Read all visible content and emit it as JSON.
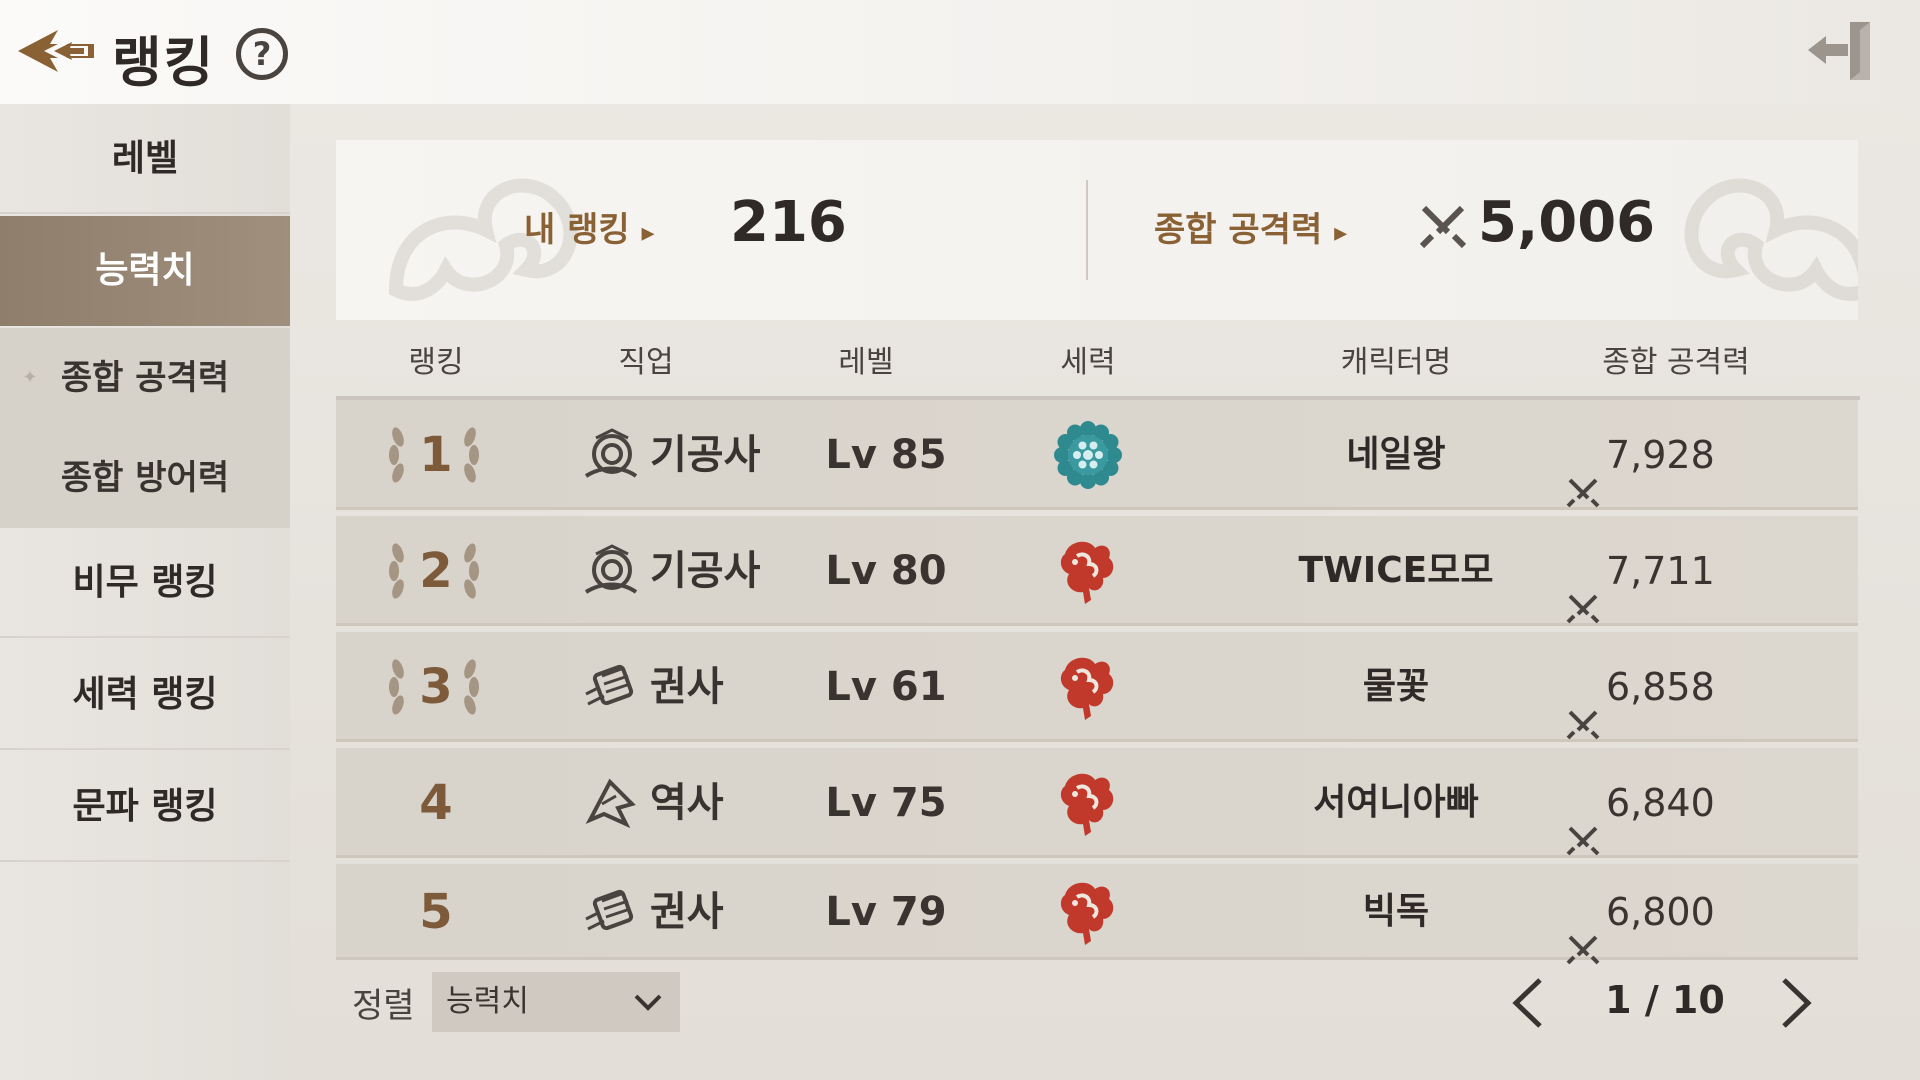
{
  "header": {
    "title": "랭킹",
    "help": "?"
  },
  "sidebar": {
    "items": [
      "레벨",
      "능력치",
      "비무 랭킹",
      "세력 랭킹",
      "문파 랭킹"
    ],
    "active": "능력치",
    "sub_items": [
      "종합 공격력",
      "종합 방어력"
    ]
  },
  "my_rank": {
    "rank_label": "내 랭킹",
    "rank_value": "216",
    "power_label": "종합 공격력",
    "power_value": "5,006"
  },
  "table": {
    "headers": [
      "랭킹",
      "직업",
      "레벨",
      "세력",
      "캐릭터명",
      "종합 공격력"
    ],
    "rows": [
      {
        "rank": "1",
        "job": "기공사",
        "job_icon": "gigongsa-icon",
        "level": "Lv 85",
        "faction": "blue-flower-faction",
        "name": "네일왕",
        "power": "7,928"
      },
      {
        "rank": "2",
        "job": "기공사",
        "job_icon": "gigongsa-icon",
        "level": "Lv 80",
        "faction": "red-dragon-faction",
        "name": "TWICE모모",
        "power": "7,711"
      },
      {
        "rank": "3",
        "job": "권사",
        "job_icon": "gwonsa-icon",
        "level": "Lv 61",
        "faction": "red-dragon-faction",
        "name": "물꽃",
        "power": "6,858"
      },
      {
        "rank": "4",
        "job": "역사",
        "job_icon": "yeoksa-icon",
        "level": "Lv 75",
        "faction": "red-dragon-faction",
        "name": "서여니아빠",
        "power": "6,840"
      },
      {
        "rank": "5",
        "job": "권사",
        "job_icon": "gwonsa-icon",
        "level": "Lv 79",
        "faction": "red-dragon-faction",
        "name": "빅독",
        "power": "6,800"
      }
    ]
  },
  "footer": {
    "sort_label": "정렬",
    "sort_value": "능력치",
    "page": "1 / 10"
  },
  "colors": {
    "accent_text": "#8a6134",
    "active_tab": "#9a8876",
    "faction_red": "#c0392b",
    "faction_blue": "#2f8a8f"
  }
}
